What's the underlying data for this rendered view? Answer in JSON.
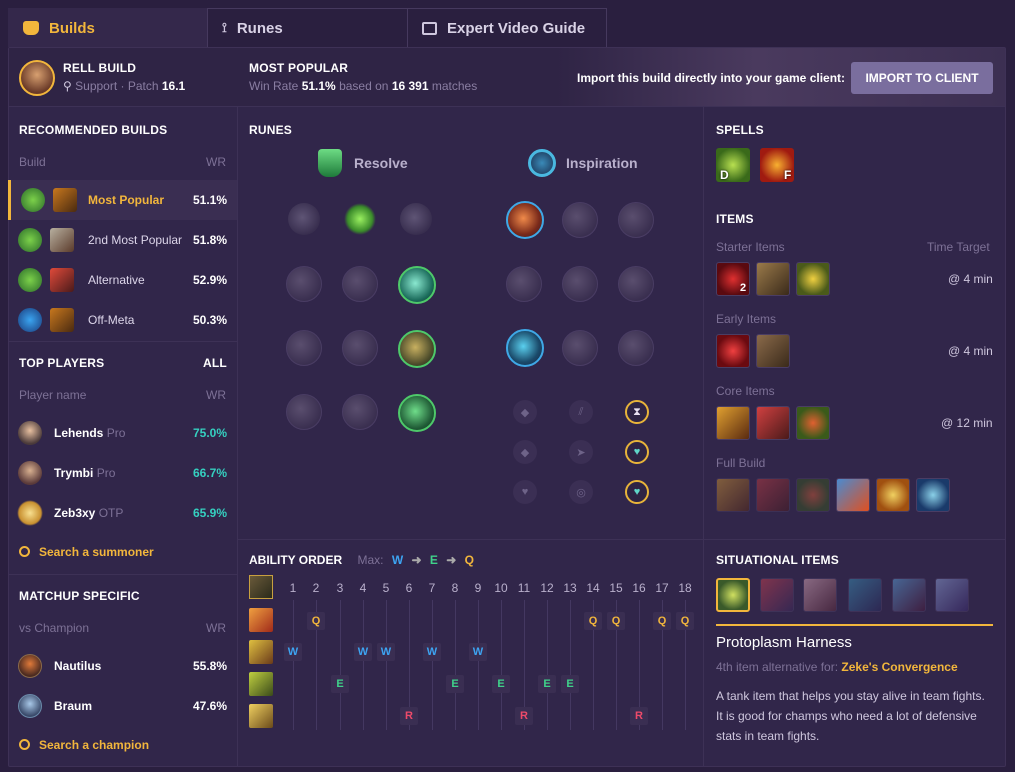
{
  "tabs": [
    {
      "label": "Builds",
      "icon": "builds-icon"
    },
    {
      "label": "Runes",
      "icon": "runes-icon"
    },
    {
      "label": "Expert Video Guide",
      "icon": "video-icon"
    }
  ],
  "header": {
    "champ": "RELL BUILD",
    "role": "Support",
    "patch_label": "Patch",
    "patch": "16.1",
    "popular_title": "MOST POPULAR",
    "winrate_label": "Win Rate",
    "winrate": "51.1%",
    "based_on": "based on",
    "matches_num": "16 391",
    "matches_label": "matches",
    "import_text": "Import this build directly into your game client:",
    "import_button": "IMPORT TO CLIENT"
  },
  "builds": {
    "title": "RECOMMENDED BUILDS",
    "col_build": "Build",
    "col_wr": "WR",
    "items": [
      {
        "name": "Most Popular",
        "wr": "51.1%"
      },
      {
        "name": "2nd Most Popular",
        "wr": "51.8%"
      },
      {
        "name": "Alternative",
        "wr": "52.9%"
      },
      {
        "name": "Off-Meta",
        "wr": "50.3%"
      }
    ]
  },
  "players": {
    "title": "TOP PLAYERS",
    "all": "ALL",
    "col_name": "Player name",
    "col_wr": "WR",
    "items": [
      {
        "name": "Lehends",
        "tag": "Pro",
        "wr": "75.0%"
      },
      {
        "name": "Trymbi",
        "tag": "Pro",
        "wr": "66.7%"
      },
      {
        "name": "Zeb3xy",
        "tag": "OTP",
        "wr": "65.9%"
      }
    ],
    "search": "Search a summoner"
  },
  "matchup": {
    "title": "MATCHUP SPECIFIC",
    "col_name": "vs Champion",
    "col_wr": "WR",
    "items": [
      {
        "name": "Nautilus",
        "wr": "55.8%"
      },
      {
        "name": "Braum",
        "wr": "47.6%"
      }
    ],
    "search": "Search a champion"
  },
  "runes": {
    "title": "RUNES",
    "primary": "Resolve",
    "secondary": "Inspiration"
  },
  "ability": {
    "title": "ABILITY ORDER",
    "max_label": "Max:",
    "max": [
      "W",
      "E",
      "Q"
    ],
    "levels": [
      "1",
      "2",
      "3",
      "4",
      "5",
      "6",
      "7",
      "8",
      "9",
      "10",
      "11",
      "12",
      "13",
      "14",
      "15",
      "16",
      "17",
      "18"
    ],
    "q": "Q",
    "w": "W",
    "e": "E",
    "r": "R"
  },
  "spells": {
    "title": "SPELLS",
    "keys": [
      "D",
      "F"
    ]
  },
  "items": {
    "title": "ITEMS",
    "starter": "Starter Items",
    "time_target": "Time Target",
    "starter_time": "@ 4 min",
    "starter_count": "2",
    "early": "Early Items",
    "early_time": "@ 4 min",
    "core": "Core Items",
    "core_time": "@ 12 min",
    "full": "Full Build"
  },
  "situational": {
    "title": "SITUATIONAL ITEMS",
    "name": "Protoplasm Harness",
    "alt_label": "4th item alternative for:",
    "alt_item": "Zeke's Convergence",
    "desc": "A tank item that helps you stay alive in team fights. It is good for champs who need a lot of defensive stats in team fights."
  },
  "colors": {
    "accent": "#f2b63c",
    "teal": "#35d0c0",
    "q": "#f2b63c",
    "w": "#3da4f2",
    "e": "#3fd28a",
    "r": "#ee4a6a"
  }
}
